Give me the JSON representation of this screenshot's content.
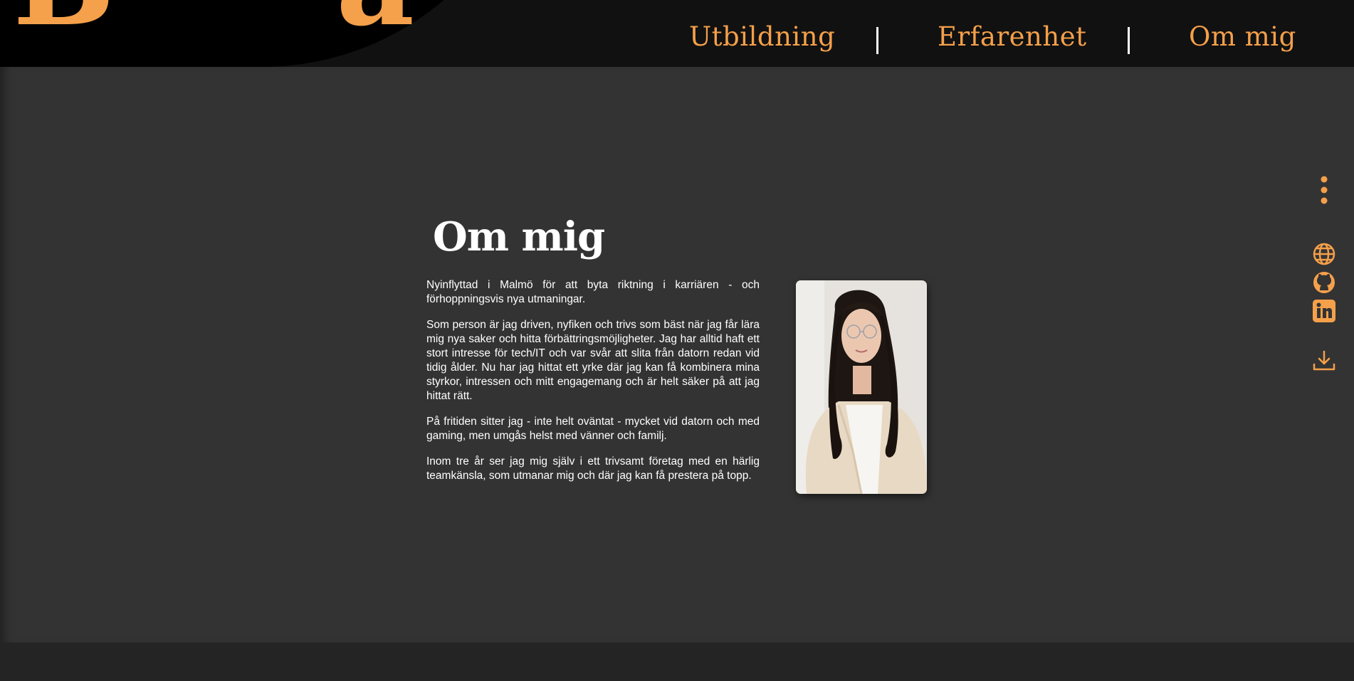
{
  "header": {
    "logo_letters": [
      "B",
      "a"
    ],
    "nav": [
      {
        "label": "Utbildning"
      },
      {
        "label": "Erfarenhet"
      },
      {
        "label": "Om mig"
      }
    ],
    "separator": "|"
  },
  "about": {
    "title": "Om mig",
    "paragraphs": [
      "Nyinflyttad i Malmö för att byta riktning i karriären - och förhoppningsvis nya utmaningar.",
      "Som person är jag driven, nyfiken och trivs som bäst när jag får lära mig nya saker och hitta förbättringsmöjligheter. Jag har alltid haft ett stort intresse för tech/IT och var svår att slita från datorn redan vid tidig ålder. Nu har jag hittat ett yrke där jag kan få kombinera mina styrkor, intressen och mitt engagemang och är helt säker på att jag hittat rätt.",
      "På fritiden sitter jag - inte helt oväntat - mycket vid datorn och med gaming, men umgås helst med vänner och familj.",
      "Inom tre år ser jag mig själv i ett trivsamt företag med en härlig teamkänsla, som utmanar mig och där jag kan få prestera på topp."
    ]
  },
  "sidebar": {
    "icons": [
      "more-vertical-icon",
      "globe-icon",
      "github-icon",
      "linkedin-icon",
      "download-icon"
    ]
  },
  "colors": {
    "accent": "#f5a04a",
    "header_bg": "#111111",
    "logo_panel_bg": "#000000",
    "main_bg": "#333333",
    "footer_bg": "#242424",
    "text": "#ffffff"
  }
}
